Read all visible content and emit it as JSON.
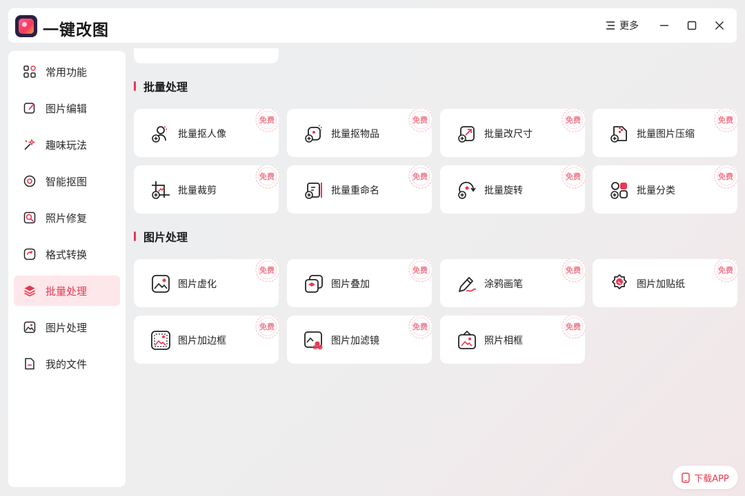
{
  "app": {
    "title": "一键改图",
    "more_label": "更多",
    "download_label": "下载APP"
  },
  "sidebar": {
    "items": [
      {
        "label": "常用功能",
        "icon": "grid-icon"
      },
      {
        "label": "图片编辑",
        "icon": "edit-icon"
      },
      {
        "label": "趣味玩法",
        "icon": "magic-wand-icon"
      },
      {
        "label": "智能抠图",
        "icon": "target-icon"
      },
      {
        "label": "照片修复",
        "icon": "repair-icon"
      },
      {
        "label": "格式转换",
        "icon": "convert-icon"
      },
      {
        "label": "批量处理",
        "icon": "layers-icon",
        "active": true
      },
      {
        "label": "图片处理",
        "icon": "image-icon"
      },
      {
        "label": "我的文件",
        "icon": "file-icon"
      }
    ]
  },
  "sections": [
    {
      "title": "批量处理",
      "cards": [
        {
          "label": "批量抠人像",
          "badge": "免费",
          "icon": "portrait-cutout-icon"
        },
        {
          "label": "批量抠物品",
          "badge": "免费",
          "icon": "object-cutout-icon"
        },
        {
          "label": "批量改尺寸",
          "badge": "免费",
          "icon": "resize-icon"
        },
        {
          "label": "批量图片压缩",
          "badge": "免费",
          "icon": "compress-icon"
        },
        {
          "label": "批量裁剪",
          "badge": "免费",
          "icon": "crop-icon"
        },
        {
          "label": "批量重命名",
          "badge": "免费",
          "icon": "rename-icon"
        },
        {
          "label": "批量旋转",
          "badge": "免费",
          "icon": "rotate-icon"
        },
        {
          "label": "批量分类",
          "badge": "免费",
          "icon": "classify-icon"
        }
      ]
    },
    {
      "title": "图片处理",
      "cards": [
        {
          "label": "图片虚化",
          "badge": "免费",
          "icon": "blur-icon"
        },
        {
          "label": "图片叠加",
          "badge": "免费",
          "icon": "overlay-icon"
        },
        {
          "label": "涂鸦画笔",
          "badge": "免费",
          "icon": "pen-icon"
        },
        {
          "label": "图片加贴纸",
          "badge": "免费",
          "icon": "sticker-icon"
        },
        {
          "label": "图片加边框",
          "badge": "免费",
          "icon": "border-icon"
        },
        {
          "label": "图片加滤镜",
          "badge": "免费",
          "icon": "filter-icon"
        },
        {
          "label": "照片相框",
          "badge": "免费",
          "icon": "photo-frame-icon"
        }
      ]
    }
  ],
  "colors": {
    "accent": "#e8384f",
    "badge": "#f07d8e",
    "active_bg": "#fde7ea"
  }
}
